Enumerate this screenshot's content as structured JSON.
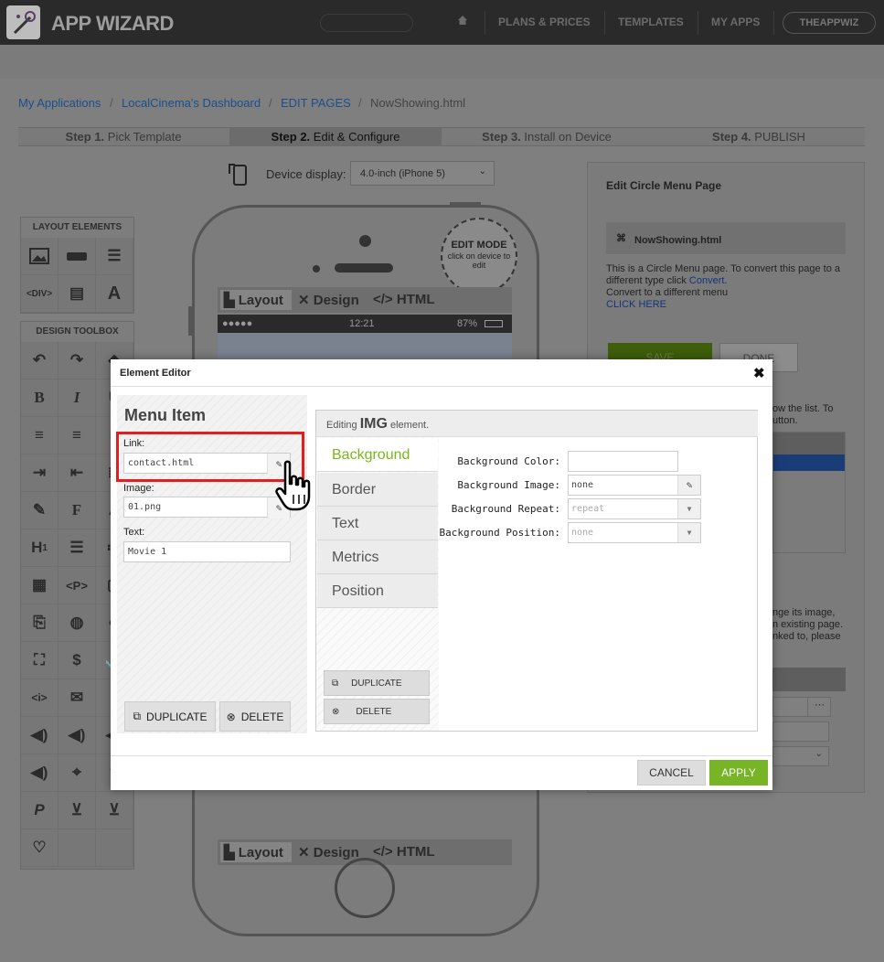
{
  "header": {
    "brand": "APP WIZARD",
    "nav": [
      "PLANS & PRICES",
      "TEMPLATES",
      "MY APPS"
    ],
    "user": "THEAPPWIZ"
  },
  "breadcrumb": [
    "My Applications",
    "LocalCinema's Dashboard",
    "EDIT PAGES",
    "NowShowing.html"
  ],
  "steps": [
    {
      "num": "Step 1.",
      "label": "Pick Template"
    },
    {
      "num": "Step 2.",
      "label": "Edit & Configure"
    },
    {
      "num": "Step 3.",
      "label": "Install on Device"
    },
    {
      "num": "Step 4.",
      "label": "PUBLISH"
    }
  ],
  "device": {
    "label": "Device display:",
    "value": "4.0-inch (iPhone 5)"
  },
  "palettes": {
    "layout_title": "LAYOUT ELEMENTS",
    "design_title": "DESIGN TOOLBOX"
  },
  "phone": {
    "edit_mode": "EDIT MODE",
    "edit_hint": "click on device to edit",
    "tabs": [
      "Layout",
      "Design",
      "HTML"
    ],
    "status_signal": "●●●●● ",
    "status_time": "12:21",
    "status_battery": "87%"
  },
  "right_panel": {
    "title": "Edit Circle Menu Page",
    "file": "NowShowing.html",
    "desc1": "This is a Circle Menu page. To convert this page to a different type click ",
    "convert": "Convert.",
    "desc2": "Convert to a different menu",
    "click_here": "CLICK HERE",
    "save": "SAVE",
    "done": "DONE",
    "side1": "ow the list. To",
    "side2": "utton.",
    "side3": "nge its image,",
    "side4": "n existing page.",
    "side5": "nked to, please"
  },
  "modal": {
    "title": "Element Editor",
    "close": "✖",
    "menu_item_title": "Menu Item",
    "link_label": "Link:",
    "link_value": "contact.html",
    "image_label": "Image:",
    "image_value": "01.png",
    "text_label": "Text:",
    "text_value": "Movie 1",
    "duplicate": "DUPLICATE",
    "delete": "DELETE",
    "editing_prefix": "Editing ",
    "editing_tag": "IMG",
    "editing_suffix": " element.",
    "tabs": [
      "Background",
      "Border",
      "Text",
      "Metrics",
      "Position"
    ],
    "props": [
      {
        "label": "Background Color:",
        "value": ""
      },
      {
        "label": "Background Image:",
        "value": "none"
      },
      {
        "label": "Background Repeat:",
        "value": "repeat"
      },
      {
        "label": "Background Position:",
        "value": "none"
      }
    ],
    "cancel": "CANCEL",
    "apply": "APPLY"
  },
  "colors": {
    "accent_green": "#78b526",
    "highlight_red": "#e02020",
    "link_blue": "#1a4f8c"
  }
}
